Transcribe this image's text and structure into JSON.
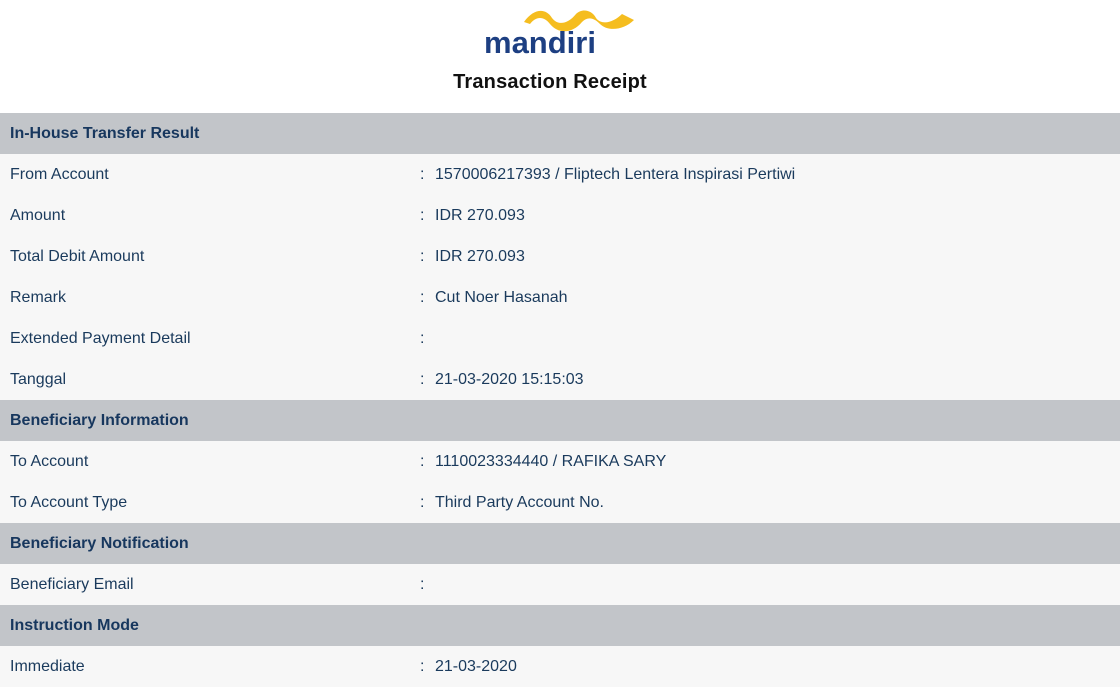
{
  "header": {
    "logo_text": "mandiri",
    "title": "Transaction Receipt"
  },
  "colors": {
    "brand_blue": "#1d3f82",
    "brand_gold": "#f5bd1f",
    "section_bg": "#c2c5c9",
    "row_bg": "#f7f7f7",
    "text": "#1a3a5c"
  },
  "sections": {
    "transfer": {
      "heading": "In-House Transfer Result",
      "rows": [
        {
          "label": "From Account",
          "value": "1570006217393 / Fliptech Lentera Inspirasi Pertiwi"
        },
        {
          "label": "Amount",
          "value": "IDR 270.093"
        },
        {
          "label": "Total Debit Amount",
          "value": "IDR 270.093"
        },
        {
          "label": "Remark",
          "value": "Cut Noer Hasanah"
        },
        {
          "label": "Extended Payment Detail",
          "value": ""
        },
        {
          "label": "Tanggal",
          "value": "21-03-2020 15:15:03"
        }
      ]
    },
    "beneficiary": {
      "heading": "Beneficiary Information",
      "rows": [
        {
          "label": "To Account",
          "value": "1110023334440 / RAFIKA SARY"
        },
        {
          "label": "To Account Type",
          "value": "Third Party Account No."
        }
      ]
    },
    "notification": {
      "heading": "Beneficiary Notification",
      "rows": [
        {
          "label": "Beneficiary Email",
          "value": ""
        }
      ]
    },
    "instruction": {
      "heading": "Instruction Mode",
      "rows": [
        {
          "label": "Immediate",
          "value": "21-03-2020"
        }
      ]
    }
  },
  "separator": ":"
}
